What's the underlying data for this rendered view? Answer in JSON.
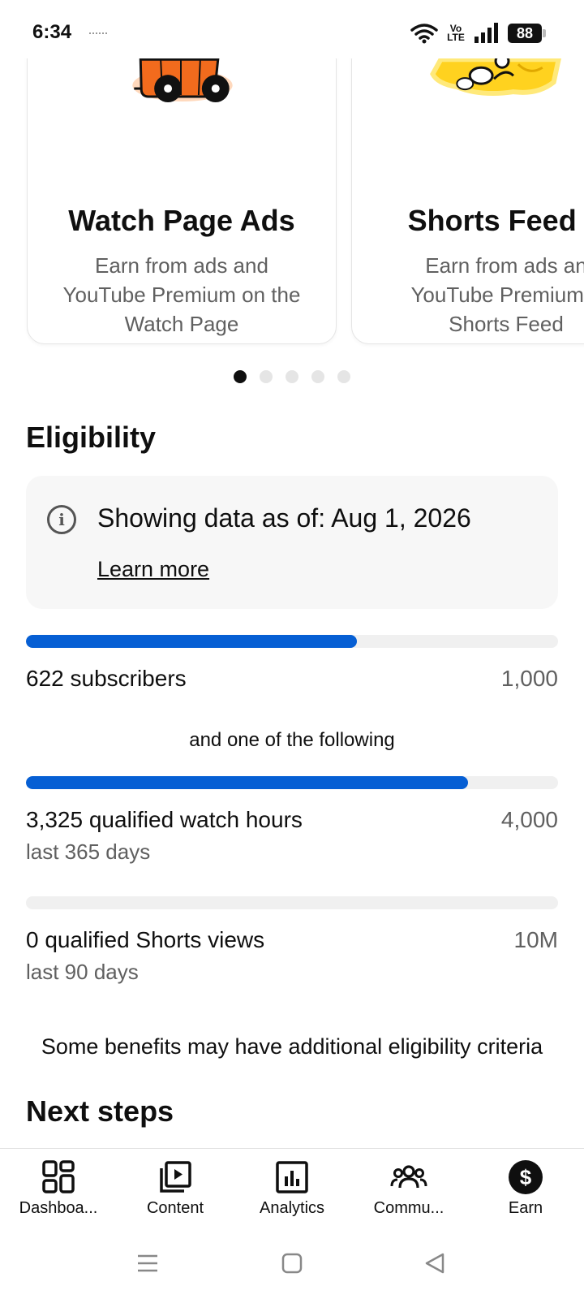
{
  "status_bar": {
    "time": "6:34",
    "network": "Vo LTE",
    "battery": "88"
  },
  "carousel": {
    "cards": [
      {
        "title": "Watch Page Ads",
        "description": "Earn from ads and\nYouTube Premium on the\nWatch Page"
      },
      {
        "title": "Shorts Feed A",
        "description": "Earn from ads an\nYouTube Premium ir\nShorts Feed"
      }
    ],
    "page_count": 5,
    "active_page": 1
  },
  "eligibility": {
    "title": "Eligibility",
    "info_text": "Showing data as of: Aug 1, 2026",
    "learn_more": "Learn more",
    "subscribers": {
      "label": "622 subscribers",
      "target": "1,000",
      "progress": 0.622
    },
    "connector": "and one of the following",
    "watch_hours": {
      "label": "3,325 qualified watch hours",
      "sub": "last 365 days",
      "target": "4,000",
      "progress": 0.831
    },
    "shorts_views": {
      "label": "0 qualified Shorts views",
      "sub": "last 90 days",
      "target": "10M",
      "progress": 0
    },
    "note": "Some benefits may have additional eligibility criteria"
  },
  "next_steps": {
    "title": "Next steps"
  },
  "bottom_nav": {
    "items": [
      {
        "label": "Dashboa...",
        "icon": "dashboard-icon"
      },
      {
        "label": "Content",
        "icon": "content-icon"
      },
      {
        "label": "Analytics",
        "icon": "analytics-icon"
      },
      {
        "label": "Commu...",
        "icon": "community-icon"
      },
      {
        "label": "Earn",
        "icon": "earn-icon"
      }
    ],
    "active": "Earn"
  },
  "colors": {
    "progress_fill": "#065fd4",
    "progress_track": "#f0f0f0",
    "secondary_text": "#606060",
    "illustration_orange": "#f26b1d",
    "illustration_yellow": "#ffd21f"
  }
}
